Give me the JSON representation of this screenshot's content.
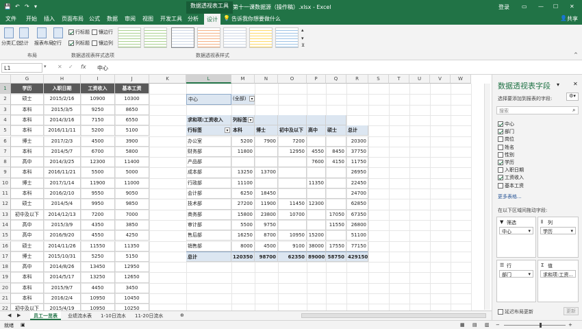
{
  "titlebar": {
    "context_tab": "数据透视表工具",
    "doc_title": "第十一课数据源（操作稿）.xlsx - Excel",
    "login": "登录"
  },
  "tabs": [
    "文件",
    "开始",
    "插入",
    "页面布局",
    "公式",
    "数据",
    "审阅",
    "视图",
    "开发工具",
    "分析",
    "设计"
  ],
  "tell_me": "告诉我你想要做什么",
  "share": "共享",
  "ribbon": {
    "layout_buttons": [
      "分类汇总",
      "总计",
      "报表布局",
      "空行"
    ],
    "layout_group": "布局",
    "options": [
      {
        "label": "行标题",
        "checked": true
      },
      {
        "label": "镶边行",
        "checked": false
      },
      {
        "label": "列标题",
        "checked": true
      },
      {
        "label": "镶边列",
        "checked": false
      }
    ],
    "options_group": "数据透视表样式选项",
    "styles_group": "数据透视表样式"
  },
  "formula": {
    "name_box": "L1",
    "content": "中心",
    "fx": "fx"
  },
  "columns": [
    "G",
    "H",
    "I",
    "J",
    "K",
    "L",
    "M",
    "N",
    "O",
    "P",
    "Q",
    "R",
    "S",
    "T",
    "U",
    "V",
    "W"
  ],
  "rows": [
    "1",
    "2",
    "3",
    "4",
    "5",
    "6",
    "7",
    "8",
    "9",
    "10",
    "11",
    "12",
    "13",
    "14",
    "15",
    "16",
    "17",
    "18",
    "19",
    "20",
    "21",
    "22"
  ],
  "source_headers": [
    "学历",
    "入职日期",
    "工资收入",
    "基本工资"
  ],
  "source_rows": [
    [
      "硕士",
      "2015/2/16",
      "10900",
      "10300"
    ],
    [
      "本科",
      "2015/3/5",
      "9250",
      "8650"
    ],
    [
      "本科",
      "2014/3/16",
      "7150",
      "6550"
    ],
    [
      "本科",
      "2016/11/11",
      "5200",
      "5100"
    ],
    [
      "博士",
      "2017/2/3",
      "4500",
      "3900"
    ],
    [
      "本科",
      "2014/5/7",
      "6700",
      "5800"
    ],
    [
      "高中",
      "2014/3/25",
      "12300",
      "11400"
    ],
    [
      "本科",
      "2016/11/21",
      "5500",
      "5000"
    ],
    [
      "博士",
      "2017/1/14",
      "11900",
      "11000"
    ],
    [
      "本科",
      "2016/2/10",
      "9550",
      "9050"
    ],
    [
      "硕士",
      "2014/5/4",
      "9950",
      "9850"
    ],
    [
      "初中及以下",
      "2014/12/13",
      "7200",
      "7000"
    ],
    [
      "高中",
      "2015/3/9",
      "4350",
      "3850"
    ],
    [
      "高中",
      "2016/9/20",
      "4550",
      "4250"
    ],
    [
      "硕士",
      "2014/11/26",
      "11550",
      "11350"
    ],
    [
      "博士",
      "2015/10/31",
      "5250",
      "5150"
    ],
    [
      "高中",
      "2014/8/26",
      "13450",
      "12950"
    ],
    [
      "本科",
      "2014/5/17",
      "13250",
      "12650"
    ],
    [
      "本科",
      "2015/9/7",
      "4450",
      "3450"
    ],
    [
      "本科",
      "2016/2/4",
      "10950",
      "10450"
    ],
    [
      "初中及以下",
      "2015/4/19",
      "10950",
      "10250"
    ]
  ],
  "pivot": {
    "filter_label": "中心",
    "filter_value": "(全部)",
    "sum_label": "求和项:工资收入",
    "col_label": "列标签",
    "row_label": "行标签",
    "col_headers": [
      "本科",
      "博士",
      "初中及以下",
      "高中",
      "硕士",
      "总计"
    ],
    "rows": [
      [
        "办公室",
        "5200",
        "7900",
        "7200",
        "",
        "",
        "20300"
      ],
      [
        "财务部",
        "11800",
        "",
        "12950",
        "4550",
        "8450",
        "37750"
      ],
      [
        "产品部",
        "",
        "",
        "",
        "7600",
        "4150",
        "11750"
      ],
      [
        "成本部",
        "13250",
        "13700",
        "",
        "",
        "",
        "26950"
      ],
      [
        "行政部",
        "11100",
        "",
        "",
        "11350",
        "",
        "22450"
      ],
      [
        "会计部",
        "6250",
        "18450",
        "",
        "",
        "",
        "24700"
      ],
      [
        "技术部",
        "27200",
        "11900",
        "11450",
        "12300",
        "",
        "62850"
      ],
      [
        "商务部",
        "15800",
        "23800",
        "10700",
        "",
        "17050",
        "67350"
      ],
      [
        "审计部",
        "5500",
        "9750",
        "",
        "",
        "11550",
        "26800"
      ],
      [
        "售后部",
        "16250",
        "8700",
        "10950",
        "15200",
        "",
        "51100"
      ],
      [
        "销售部",
        "8000",
        "4500",
        "9100",
        "38000",
        "17550",
        "77150"
      ]
    ],
    "total": [
      "总计",
      "120350",
      "98700",
      "62350",
      "89000",
      "58750",
      "429150"
    ]
  },
  "sheet_tabs": [
    "员工一览表",
    "业绩流水表",
    "1-10日流水",
    "11-20日流水"
  ],
  "status": {
    "ready": "就绪"
  },
  "pane": {
    "title": "数据透视表字段",
    "subtitle": "选择要添加到报表的字段:",
    "search_placeholder": "搜索",
    "fields": [
      {
        "label": "中心",
        "checked": true
      },
      {
        "label": "部门",
        "checked": true
      },
      {
        "label": "岗位",
        "checked": false
      },
      {
        "label": "姓名",
        "checked": false
      },
      {
        "label": "性别",
        "checked": false
      },
      {
        "label": "学历",
        "checked": true
      },
      {
        "label": "入职日期",
        "checked": false
      },
      {
        "label": "工资收入",
        "checked": true
      },
      {
        "label": "基本工资",
        "checked": false
      }
    ],
    "more_tables": "更多表格...",
    "drag_hint": "在以下区域间拖动字段:",
    "filter_area": "筛选",
    "columns_area": "列",
    "rows_area": "行",
    "values_area": "值",
    "filter_item": "中心",
    "columns_item": "学历",
    "rows_item": "部门",
    "values_item": "求和项:工资...",
    "defer": "延迟布局更新",
    "update": "更新"
  }
}
